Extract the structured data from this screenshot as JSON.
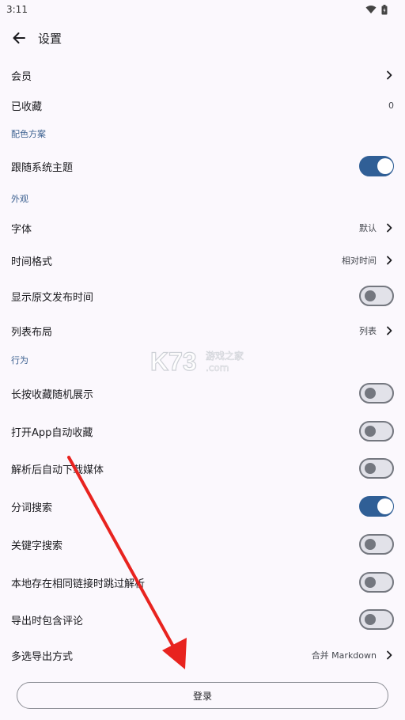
{
  "status_bar": {
    "time": "3:11"
  },
  "header": {
    "title": "设置"
  },
  "account": {
    "member_label": "会员",
    "favorites_label": "已收藏",
    "favorites_count": "0"
  },
  "sections": {
    "color_scheme": "配色方案",
    "appearance": "外观",
    "behavior": "行为"
  },
  "color_scheme": {
    "follow_system_label": "跟随系统主题",
    "follow_system_on": true
  },
  "appearance": {
    "font_label": "字体",
    "font_value": "默认",
    "time_format_label": "时间格式",
    "time_format_value": "相对时间",
    "show_publish_time_label": "显示原文发布时间",
    "show_publish_time_on": false,
    "list_layout_label": "列表布局",
    "list_layout_value": "列表"
  },
  "behavior": {
    "long_press_random_label": "长按收藏随机展示",
    "long_press_random_on": false,
    "open_app_auto_fav_label": "打开App自动收藏",
    "open_app_auto_fav_on": false,
    "auto_download_media_label": "解析后自动下载媒体",
    "auto_download_media_on": false,
    "word_seg_search_label": "分词搜索",
    "word_seg_search_on": true,
    "keyword_search_label": "关键字搜索",
    "keyword_search_on": false,
    "skip_local_dup_label": "本地存在相同链接时跳过解析",
    "skip_local_dup_on": false,
    "export_with_comments_label": "导出时包含评论",
    "export_with_comments_on": false,
    "multi_export_label": "多选导出方式",
    "multi_export_value": "合并 Markdown"
  },
  "login": {
    "label": "登录"
  },
  "watermark": {
    "brand": "K73",
    "cn": "游戏之家",
    "dotcom": ".com"
  },
  "colors": {
    "accent": "#305f96",
    "section_header": "#3a5f8f",
    "background": "#fbf8fd",
    "annotation_arrow": "#e8231f"
  },
  "icons": {
    "back": "arrow-left-icon",
    "chevron": "chevron-right-icon",
    "wifi": "wifi-icon",
    "battery": "battery-icon"
  }
}
